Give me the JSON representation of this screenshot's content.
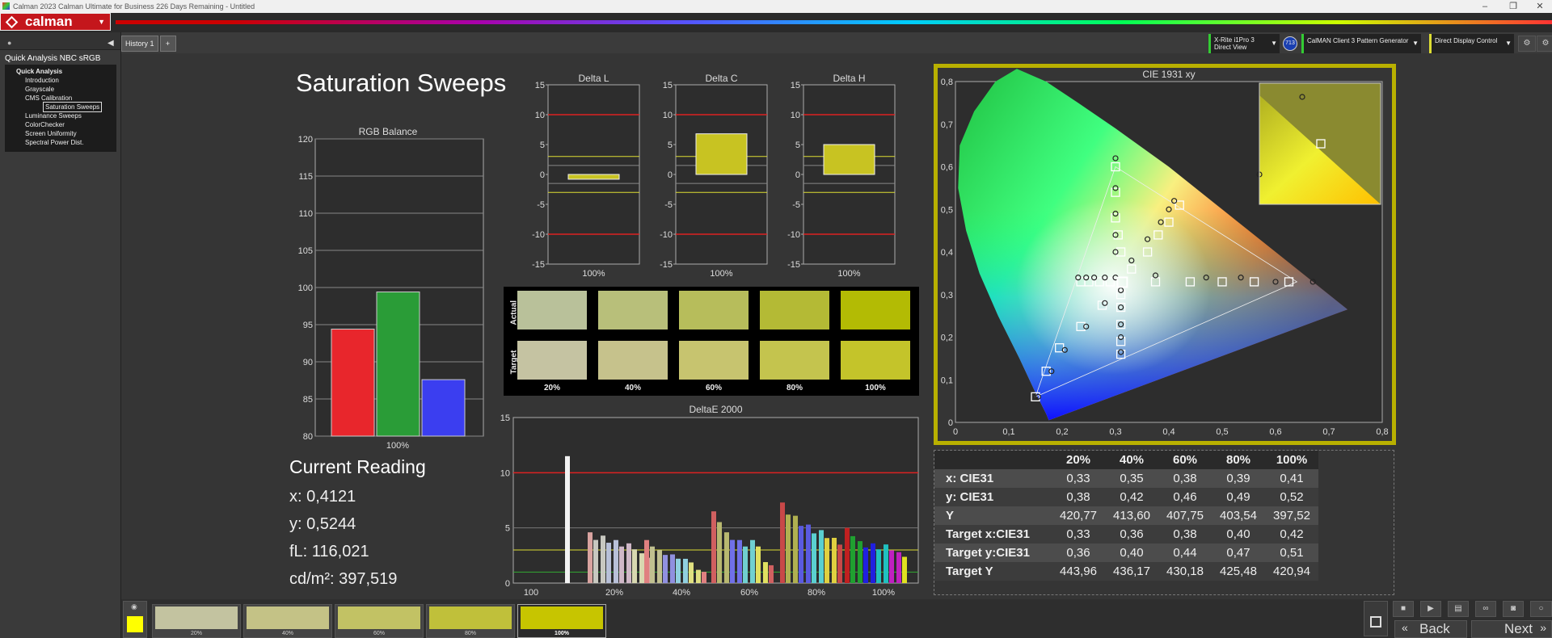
{
  "window": {
    "title": "Calman 2023 Calman Ultimate for Business 226 Days Remaining  - Untitled"
  },
  "app": {
    "logo": "calman"
  },
  "sidebar": {
    "title": "Quick Analysis NBC sRGB",
    "root": "Quick Analysis",
    "items": [
      "Introduction",
      "Grayscale",
      "CMS Calibration",
      "Saturation Sweeps",
      "Luminance Sweeps",
      "ColorChecker",
      "Screen Uniformity",
      "Spectral Power Dist."
    ],
    "selected": "Saturation Sweeps"
  },
  "tabs": [
    {
      "label": "History 1"
    }
  ],
  "devices": {
    "meter": {
      "line1": "X-Rite i1Pro 3",
      "line2": "Direct View",
      "badge": "713"
    },
    "generator": {
      "label": "CalMAN Client 3 Pattern Generator"
    },
    "display": {
      "label": "Direct Display Control"
    }
  },
  "page": {
    "title": "Saturation Sweeps"
  },
  "rgb_balance": {
    "title": "RGB Balance",
    "yticks": [
      "120",
      "115",
      "110",
      "105",
      "100",
      "95",
      "90",
      "85",
      "80"
    ],
    "xlabel": "100%",
    "chart_data": {
      "type": "bar",
      "categories": [
        "R",
        "G",
        "B"
      ],
      "values": [
        94.4,
        99.4,
        87.6
      ],
      "ylim": [
        80,
        120
      ],
      "colors": [
        "#e8262c",
        "#2a9c37",
        "#3b3ef0"
      ]
    }
  },
  "delta_charts": [
    {
      "title": "Delta L",
      "xlabel": "100%",
      "yticks": [
        "15",
        "10",
        "5",
        "0",
        "-5",
        "-10",
        "-15"
      ],
      "chart_data": {
        "type": "bar",
        "categories": [
          "100%"
        ],
        "values": [
          -0.8
        ],
        "ylim": [
          -15,
          15
        ]
      }
    },
    {
      "title": "Delta C",
      "xlabel": "100%",
      "yticks": [
        "15",
        "10",
        "5",
        "0",
        "-5",
        "-10",
        "-15"
      ],
      "chart_data": {
        "type": "bar",
        "categories": [
          "100%"
        ],
        "values": [
          6.8
        ],
        "ylim": [
          -15,
          15
        ]
      }
    },
    {
      "title": "Delta H",
      "xlabel": "100%",
      "yticks": [
        "15",
        "10",
        "5",
        "0",
        "-5",
        "-10",
        "-15"
      ],
      "chart_data": {
        "type": "bar",
        "categories": [
          "100%"
        ],
        "values": [
          5.0
        ],
        "ylim": [
          -15,
          15
        ]
      }
    }
  ],
  "swatches": {
    "row_labels": [
      "Actual",
      "Target"
    ],
    "columns": [
      {
        "label": "20%",
        "actual": "#b9c19a",
        "target": "#c5c3a2"
      },
      {
        "label": "40%",
        "actual": "#b8bf7a",
        "target": "#c6c28c"
      },
      {
        "label": "60%",
        "actual": "#b7bd5b",
        "target": "#c7c46f"
      },
      {
        "label": "80%",
        "actual": "#b4ba35",
        "target": "#c4c44e"
      },
      {
        "label": "100%",
        "actual": "#b3bb04",
        "target": "#c4c42a"
      }
    ]
  },
  "deltae": {
    "title": "DeltaE 2000",
    "yticks": [
      "15",
      "10",
      "5",
      "0"
    ],
    "xlabels": [
      "100",
      "20%",
      "40%",
      "60%",
      "80%",
      "100%"
    ],
    "chart_data": {
      "type": "bar",
      "categories": [
        "100",
        "20%",
        "40%",
        "60%",
        "80%",
        "100%"
      ],
      "ylim": [
        0,
        15
      ],
      "series": [
        {
          "values": [
            11.5
          ]
        },
        {
          "values": [
            4.6,
            3.9,
            6.5,
            7.3,
            5.0,
            6.6
          ]
        },
        {
          "values": [
            4.3,
            3.0,
            4.6,
            6.1,
            3.8,
            4.6
          ]
        },
        {
          "values": [
            3.9,
            2.6,
            3.9,
            5.3,
            3.6,
            4.2
          ]
        },
        {
          "values": [
            3.6,
            2.2,
            3.9,
            4.8,
            3.5,
            3.9
          ]
        },
        {
          "values": [
            2.7,
            1.2,
            1.9,
            4.1,
            2.8,
            3.0
          ]
        }
      ]
    }
  },
  "current_reading": {
    "heading": "Current Reading",
    "x": "x: 0,4121",
    "y": "y: 0,5244",
    "fl": "fL: 116,021",
    "cdm2": "cd/m²: 397,519"
  },
  "cie": {
    "title": "CIE 1931 xy",
    "xticks": [
      "0",
      "0,1",
      "0,2",
      "0,3",
      "0,4",
      "0,5",
      "0,6",
      "0,7",
      "0,8"
    ],
    "yticks": [
      "0,8",
      "0,7",
      "0,6",
      "0,5",
      "0,4",
      "0,3",
      "0,2",
      "0,1",
      "0"
    ],
    "chart_data": {
      "type": "scatter",
      "xlim": [
        0,
        0.8
      ],
      "ylim": [
        0,
        0.8
      ],
      "gamut": [
        [
          0.64,
          0.33
        ],
        [
          0.3,
          0.6
        ],
        [
          0.15,
          0.06
        ]
      ],
      "white": [
        0.3127,
        0.329
      ],
      "targets": [
        [
          0.625,
          0.33
        ],
        [
          0.56,
          0.33
        ],
        [
          0.5,
          0.33
        ],
        [
          0.44,
          0.33
        ],
        [
          0.375,
          0.33
        ],
        [
          0.3,
          0.6
        ],
        [
          0.3,
          0.54
        ],
        [
          0.3,
          0.48
        ],
        [
          0.305,
          0.44
        ],
        [
          0.31,
          0.4
        ],
        [
          0.15,
          0.06
        ],
        [
          0.17,
          0.12
        ],
        [
          0.195,
          0.175
        ],
        [
          0.235,
          0.225
        ],
        [
          0.275,
          0.275
        ],
        [
          0.33,
          0.36
        ],
        [
          0.36,
          0.4
        ],
        [
          0.38,
          0.44
        ],
        [
          0.4,
          0.47
        ],
        [
          0.42,
          0.51
        ],
        [
          0.235,
          0.33
        ],
        [
          0.25,
          0.33
        ],
        [
          0.27,
          0.33
        ],
        [
          0.29,
          0.33
        ],
        [
          0.31,
          0.3
        ],
        [
          0.31,
          0.27
        ],
        [
          0.31,
          0.23
        ],
        [
          0.31,
          0.19
        ],
        [
          0.31,
          0.16
        ]
      ],
      "measured": [
        [
          0.67,
          0.33
        ],
        [
          0.6,
          0.33
        ],
        [
          0.535,
          0.34
        ],
        [
          0.47,
          0.34
        ],
        [
          0.375,
          0.345
        ],
        [
          0.3,
          0.62
        ],
        [
          0.3,
          0.55
        ],
        [
          0.3,
          0.49
        ],
        [
          0.3,
          0.44
        ],
        [
          0.3,
          0.4
        ],
        [
          0.155,
          0.06
        ],
        [
          0.18,
          0.12
        ],
        [
          0.205,
          0.17
        ],
        [
          0.245,
          0.225
        ],
        [
          0.28,
          0.28
        ],
        [
          0.33,
          0.38
        ],
        [
          0.36,
          0.43
        ],
        [
          0.385,
          0.47
        ],
        [
          0.4,
          0.5
        ],
        [
          0.41,
          0.52
        ],
        [
          0.23,
          0.34
        ],
        [
          0.245,
          0.34
        ],
        [
          0.26,
          0.34
        ],
        [
          0.28,
          0.34
        ],
        [
          0.3,
          0.34
        ],
        [
          0.31,
          0.31
        ],
        [
          0.31,
          0.27
        ],
        [
          0.31,
          0.23
        ],
        [
          0.31,
          0.2
        ],
        [
          0.31,
          0.165
        ]
      ]
    }
  },
  "data_table": {
    "columns": [
      "20%",
      "40%",
      "60%",
      "80%",
      "100%"
    ],
    "rows": [
      {
        "label": "x: CIE31",
        "values": [
          "0,33",
          "0,35",
          "0,38",
          "0,39",
          "0,41"
        ]
      },
      {
        "label": "y: CIE31",
        "values": [
          "0,38",
          "0,42",
          "0,46",
          "0,49",
          "0,52"
        ]
      },
      {
        "label": "Y",
        "values": [
          "420,77",
          "413,60",
          "407,75",
          "403,54",
          "397,52"
        ]
      },
      {
        "label": "Target x:CIE31",
        "values": [
          "0,33",
          "0,36",
          "0,38",
          "0,40",
          "0,42"
        ]
      },
      {
        "label": "Target y:CIE31",
        "values": [
          "0,36",
          "0,40",
          "0,44",
          "0,47",
          "0,51"
        ]
      },
      {
        "label": "Target Y",
        "values": [
          "443,96",
          "436,17",
          "430,18",
          "425,48",
          "420,94"
        ]
      }
    ]
  },
  "bottom": {
    "current_color": "#ffff00",
    "thumbnails": [
      {
        "label": "20%",
        "color": "#c3c3a0"
      },
      {
        "label": "40%",
        "color": "#c4c286"
      },
      {
        "label": "60%",
        "color": "#c2c264"
      },
      {
        "label": "80%",
        "color": "#c0c03a"
      },
      {
        "label": "100%",
        "color": "#c7c500"
      }
    ],
    "back_label": "Back",
    "next_label": "Next"
  }
}
